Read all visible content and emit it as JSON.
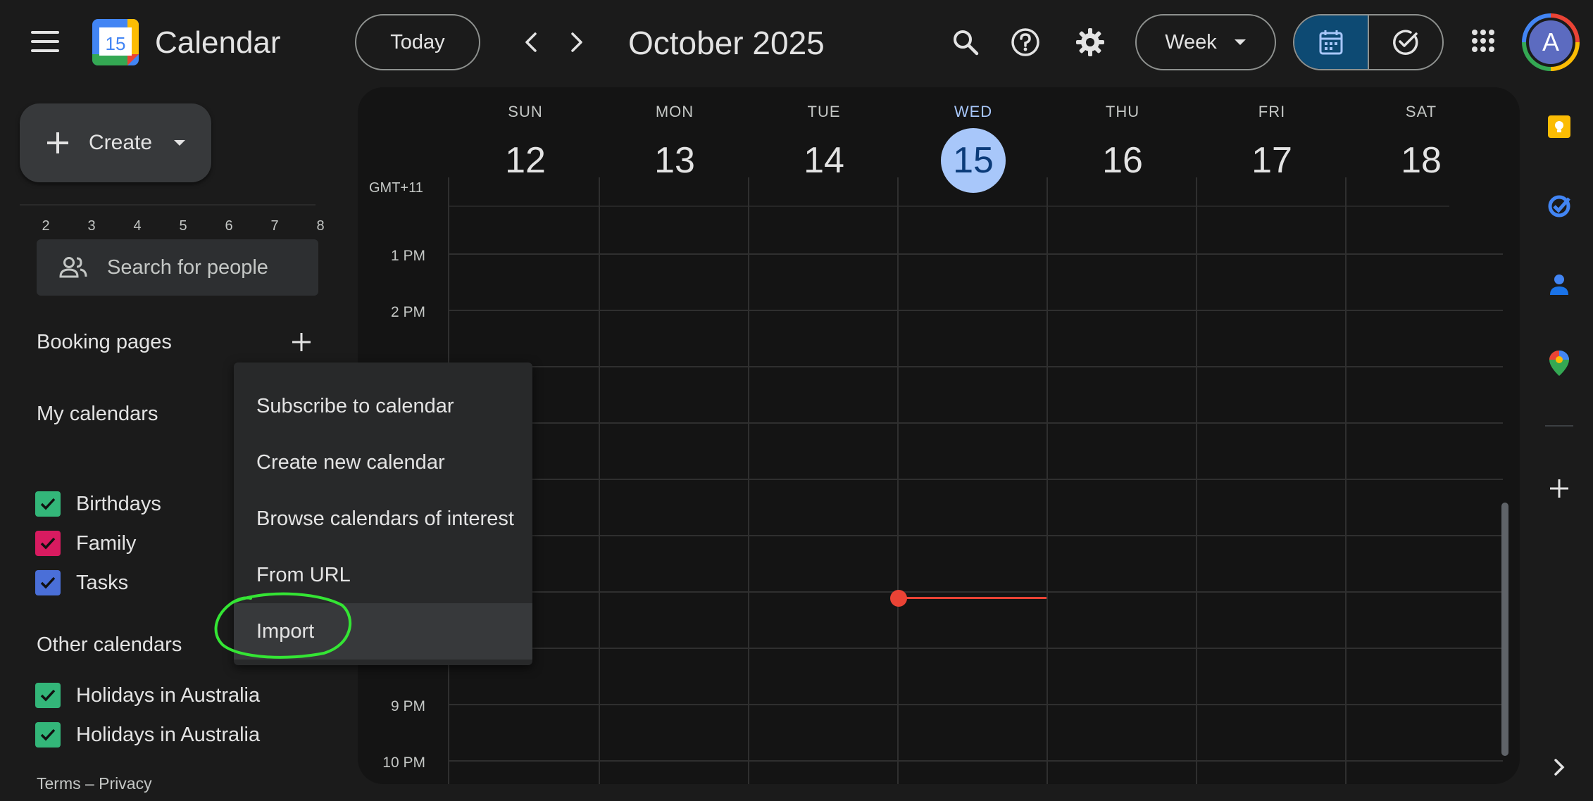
{
  "header": {
    "app_title": "Calendar",
    "logo_day": "15",
    "today_label": "Today",
    "month_title": "October 2025",
    "view_label": "Week",
    "avatar_letter": "A"
  },
  "sidebar": {
    "create_label": "Create",
    "mini_week": [
      "2",
      "3",
      "4",
      "5",
      "6",
      "7",
      "8"
    ],
    "search_placeholder": "Search for people",
    "booking_pages_title": "Booking pages",
    "my_calendars_title": "My calendars",
    "my_calendars": [
      {
        "label": "Birthdays",
        "color": "#33b679"
      },
      {
        "label": "Family",
        "color": "#d81b60"
      },
      {
        "label": "Tasks",
        "color": "#4a6fd8"
      }
    ],
    "other_calendars_title": "Other calendars",
    "other_calendars": [
      {
        "label": "Holidays in Australia",
        "color": "#33b679"
      },
      {
        "label": "Holidays in Australia",
        "color": "#33b679"
      }
    ],
    "footer_links": "Terms – Privacy"
  },
  "grid": {
    "timezone": "GMT+11",
    "days": [
      {
        "name": "SUN",
        "num": "12"
      },
      {
        "name": "MON",
        "num": "13"
      },
      {
        "name": "TUE",
        "num": "14"
      },
      {
        "name": "WED",
        "num": "15"
      },
      {
        "name": "THU",
        "num": "16"
      },
      {
        "name": "FRI",
        "num": "17"
      },
      {
        "name": "SAT",
        "num": "18"
      }
    ],
    "hours": [
      "1 PM",
      "2 PM",
      "9 PM",
      "10 PM"
    ]
  },
  "menu": {
    "items": [
      "Subscribe to calendar",
      "Create new calendar",
      "Browse calendars of interest",
      "From URL",
      "Import"
    ]
  },
  "colors": {
    "accent": "#a8c7fa",
    "now_indicator": "#ea4335",
    "highlight_ring": "#34e534"
  }
}
